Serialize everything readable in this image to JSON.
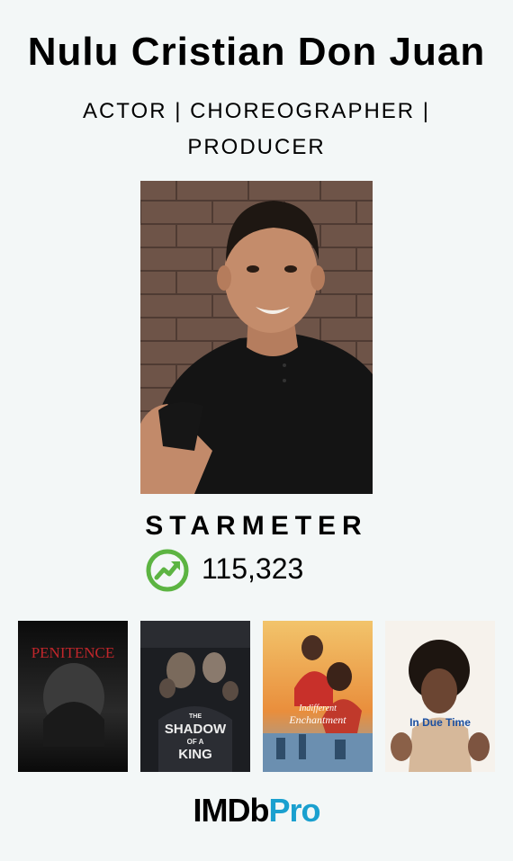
{
  "profile": {
    "name": "Nulu Cristian Don Juan",
    "roles_line1": "ACTOR | CHOREOGRAPHER |",
    "roles_line2": "PRODUCER"
  },
  "starmeter": {
    "label": "STARMETER",
    "value": "115,323",
    "trend_icon": "trend-up-icon",
    "trend_color": "#5cb442"
  },
  "posters": [
    {
      "title": "PENITENCE"
    },
    {
      "title_line1": "THE",
      "title_line2": "SHADOW",
      "title_line3": "OF A",
      "title_line4": "KING"
    },
    {
      "title_line1": "Indifferent",
      "title_line2": "Enchantment"
    },
    {
      "title": "In Due Time"
    }
  ],
  "brand": {
    "imdb": "IMDb",
    "pro": "Pro",
    "pro_color": "#1aa0cf"
  }
}
